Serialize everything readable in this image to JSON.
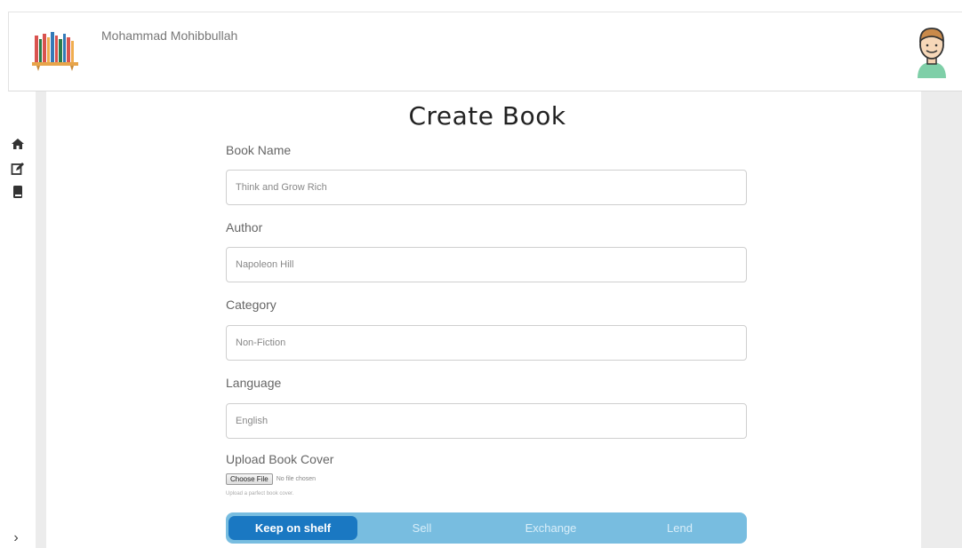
{
  "header": {
    "user_name": "Mohammad Mohibbullah"
  },
  "sidebar": {
    "icons": [
      "home-icon",
      "edit-icon",
      "book-icon"
    ],
    "expand": "›"
  },
  "form": {
    "title": "Create Book",
    "fields": [
      {
        "label": "Book Name",
        "value": "Think and Grow Rich"
      },
      {
        "label": "Author",
        "value": "Napoleon Hill"
      },
      {
        "label": "Category",
        "value": "Non-Fiction"
      },
      {
        "label": "Language",
        "value": "English"
      }
    ],
    "upload": {
      "label": "Upload Book Cover",
      "button": "Choose File",
      "status": "No file chosen",
      "hint": "Upload a parfect book cover."
    },
    "actions": {
      "selected": "Keep on shelf",
      "options": [
        "Keep on shelf",
        "Sell",
        "Exchange",
        "Lend"
      ]
    }
  },
  "colors": {
    "accent": "#1a78c2",
    "segment_bg": "#78bde0"
  }
}
